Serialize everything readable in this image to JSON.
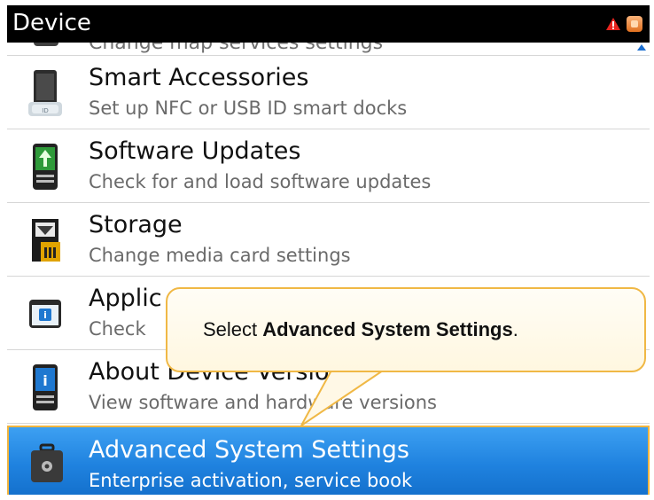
{
  "header": {
    "title": "Device",
    "icons": [
      "warning-icon",
      "lock-icon"
    ]
  },
  "partial_item": {
    "subtitle": "Change map services settings"
  },
  "items": [
    {
      "title": "Smart Accessories",
      "subtitle": "Set up NFC or USB ID smart docks",
      "icon": "smart-dock-icon"
    },
    {
      "title": "Software Updates",
      "subtitle": "Check for and load software updates",
      "icon": "software-update-icon"
    },
    {
      "title": "Storage",
      "subtitle": "Change media card settings",
      "icon": "media-card-icon"
    },
    {
      "title": "Applic",
      "subtitle": "Check",
      "icon": "app-info-icon"
    },
    {
      "title": "About Device Versio",
      "subtitle": "View software and hardware versions",
      "icon": "device-info-icon"
    },
    {
      "title": "Advanced System Settings",
      "subtitle": "Enterprise activation, service book",
      "icon": "toolbox-icon",
      "selected": true
    }
  ],
  "callout": {
    "prefix": "Select ",
    "bold": "Advanced System Settings",
    "suffix": "."
  },
  "colors": {
    "selected_bg": "#1f82df",
    "callout_border": "#f0b845",
    "header_bg": "#000000"
  }
}
